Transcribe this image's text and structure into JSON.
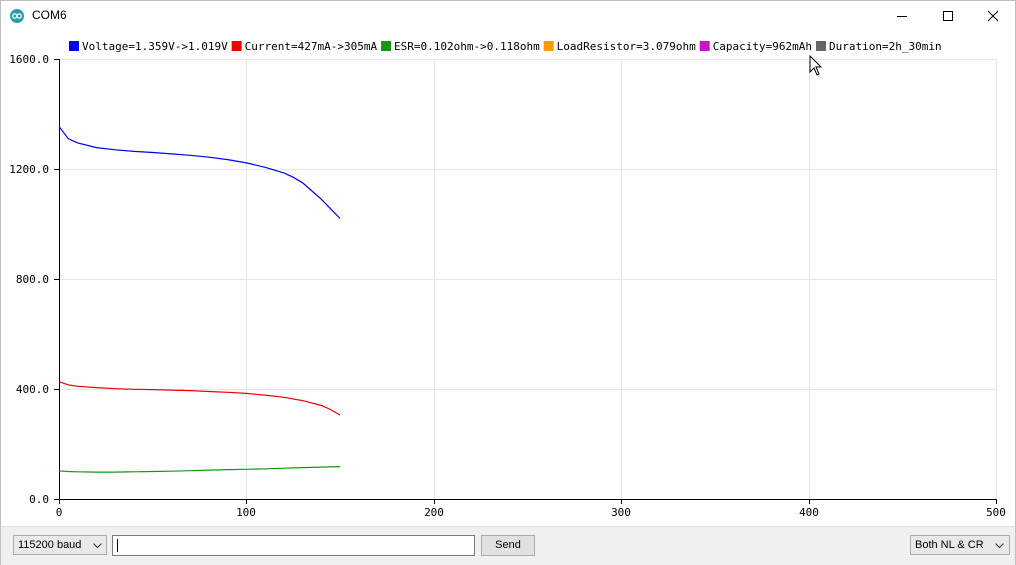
{
  "window": {
    "title": "COM6"
  },
  "bottom_bar": {
    "baud": "115200 baud",
    "line_ending": "Both NL & CR",
    "send_label": "Send",
    "input_value": ""
  },
  "chart_data": {
    "type": "line",
    "xlim": [
      0,
      500
    ],
    "ylim": [
      0,
      1600
    ],
    "x_ticks": [
      "0",
      "100",
      "200",
      "300",
      "400",
      "500"
    ],
    "y_ticks": [
      "0.0",
      "400.0",
      "800.0",
      "1200.0",
      "1600.0"
    ],
    "grid": true,
    "legend_position": "top",
    "series": [
      {
        "name": "Voltage=1.359V->1.019V",
        "color": "#0000ee",
        "x": [
          0,
          5,
          10,
          20,
          30,
          40,
          50,
          60,
          70,
          80,
          90,
          100,
          110,
          120,
          125,
          130,
          135,
          140,
          145,
          150
        ],
        "y": [
          1355,
          1310,
          1295,
          1278,
          1270,
          1264,
          1260,
          1255,
          1250,
          1243,
          1234,
          1222,
          1206,
          1186,
          1170,
          1150,
          1120,
          1090,
          1055,
          1020
        ]
      },
      {
        "name": "Current=427mA->305mA",
        "color": "#ee0000",
        "x": [
          0,
          5,
          10,
          20,
          30,
          40,
          50,
          60,
          70,
          80,
          90,
          100,
          110,
          120,
          130,
          140,
          145,
          150
        ],
        "y": [
          427,
          415,
          410,
          405,
          401,
          399,
          398,
          396,
          394,
          391,
          388,
          384,
          378,
          370,
          358,
          340,
          325,
          305
        ]
      },
      {
        "name": "ESR=0.102ohm->0.118ohm",
        "color": "#119911",
        "x": [
          0,
          5,
          10,
          20,
          30,
          40,
          50,
          60,
          70,
          80,
          90,
          100,
          110,
          120,
          130,
          140,
          150
        ],
        "y": [
          102,
          100,
          99,
          98,
          98,
          99,
          100,
          101,
          103,
          105,
          107,
          108,
          110,
          112,
          114,
          116,
          118
        ]
      },
      {
        "name": "LoadResistor=3.079ohm",
        "color": "#ff9900",
        "x": [],
        "y": []
      },
      {
        "name": "Capacity=962mAh",
        "color": "#cc11cc",
        "x": [],
        "y": []
      },
      {
        "name": "Duration=2h_30min",
        "color": "#666666",
        "x": [],
        "y": []
      }
    ]
  }
}
